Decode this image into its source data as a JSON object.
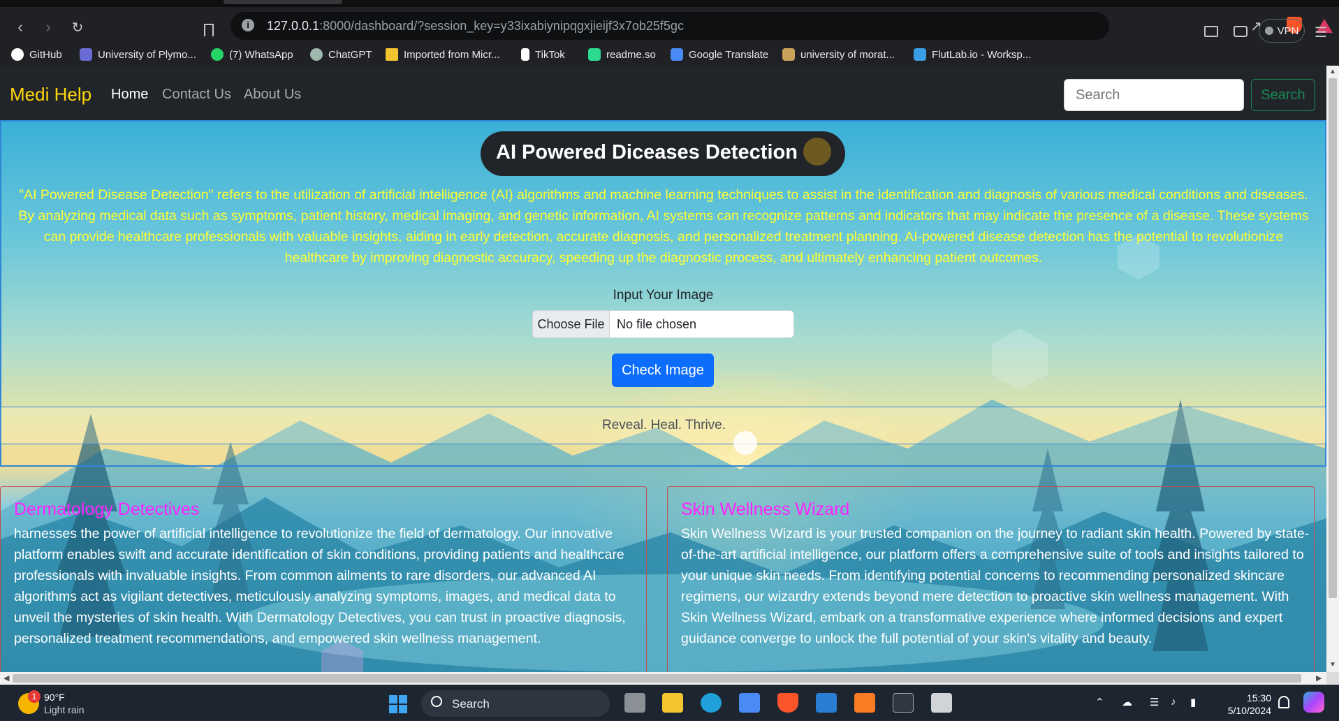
{
  "browser": {
    "url_host": "127.0.0.1",
    "url_rest": ":8000/dashboard/?session_key=y33ixabiynipqgxjieijf3x7ob25f5gc",
    "vpn_label": "VPN",
    "bookmarks": [
      {
        "label": "GitHub",
        "icon": "github-icon",
        "color": "#ffffff"
      },
      {
        "label": "University of Plymo...",
        "icon": "crest-icon",
        "color": "#6b6bd6"
      },
      {
        "label": "(7) WhatsApp",
        "icon": "whatsapp-icon",
        "color": "#25d366"
      },
      {
        "label": "ChatGPT",
        "icon": "chatgpt-icon",
        "color": "#9fb8ad"
      },
      {
        "label": "Imported from Micr...",
        "icon": "folder-icon",
        "color": "#f4c430"
      },
      {
        "label": "TikTok",
        "icon": "tiktok-icon",
        "color": "#ffffff"
      },
      {
        "label": "readme.so",
        "icon": "readme-icon",
        "color": "#2bd98f"
      },
      {
        "label": "Google Translate",
        "icon": "translate-icon",
        "color": "#4a8af4"
      },
      {
        "label": "university of morat...",
        "icon": "crest-icon",
        "color": "#c9a25a"
      },
      {
        "label": "FlutLab.io - Worksp...",
        "icon": "flutlab-icon",
        "color": "#3a9ee6"
      }
    ]
  },
  "navbar": {
    "brand": "Medi Help",
    "links": [
      "Home",
      "Contact Us",
      "About Us"
    ],
    "search_placeholder": "Search",
    "search_button": "Search"
  },
  "hero": {
    "title": "AI Powered Diceases Detection",
    "intro": "\"AI Powered Disease Detection\" refers to the utilization of artificial intelligence (AI) algorithms and machine learning techniques to assist in the identification and diagnosis of various medical conditions and diseases. By analyzing medical data such as symptoms, patient history, medical imaging, and genetic information, AI systems can recognize patterns and indicators that may indicate the presence of a disease. These systems can provide healthcare professionals with valuable insights, aiding in early detection, accurate diagnosis, and personalized treatment planning. AI-powered disease detection has the potential to revolutionize healthcare by improving diagnostic accuracy, speeding up the diagnostic process, and ultimately enhancing patient outcomes.",
    "input_label": "Input Your Image",
    "file_button": "Choose File",
    "file_status": "No file chosen",
    "check_button": "Check Image",
    "tagline": "Reveal. Heal. Thrive."
  },
  "cards": [
    {
      "title": "Dermatology Detectives",
      "body": "harnesses the power of artificial intelligence to revolutionize the field of dermatology. Our innovative platform enables swift and accurate identification of skin conditions, providing patients and healthcare professionals with invaluable insights. From common ailments to rare disorders, our advanced AI algorithms act as vigilant detectives, meticulously analyzing symptoms, images, and medical data to unveil the mysteries of skin health. With Dermatology Detectives, you can trust in proactive diagnosis, personalized treatment recommendations, and empowered skin wellness management."
    },
    {
      "title": "Skin Wellness Wizard",
      "body": "Skin Wellness Wizard is your trusted companion on the journey to radiant skin health. Powered by state-of-the-art artificial intelligence, our platform offers a comprehensive suite of tools and insights tailored to your unique skin needs. From identifying potential concerns to recommending personalized skincare regimens, our wizardry extends beyond mere detection to proactive skin wellness management. With Skin Wellness Wizard, embark on a transformative experience where informed decisions and expert guidance converge to unlock the full potential of your skin's vitality and beauty."
    }
  ],
  "taskbar": {
    "weather_temp": "90°F",
    "weather_desc": "Light rain",
    "weather_badge": "1",
    "search_label": "Search",
    "time": "15:30",
    "date": "5/10/2024"
  },
  "colors": {
    "brand": "#ffd60a",
    "intro_text": "#ffff33",
    "card_title": "#ff22ff",
    "primary_button": "#0d6efd",
    "search_button": "#198754"
  }
}
